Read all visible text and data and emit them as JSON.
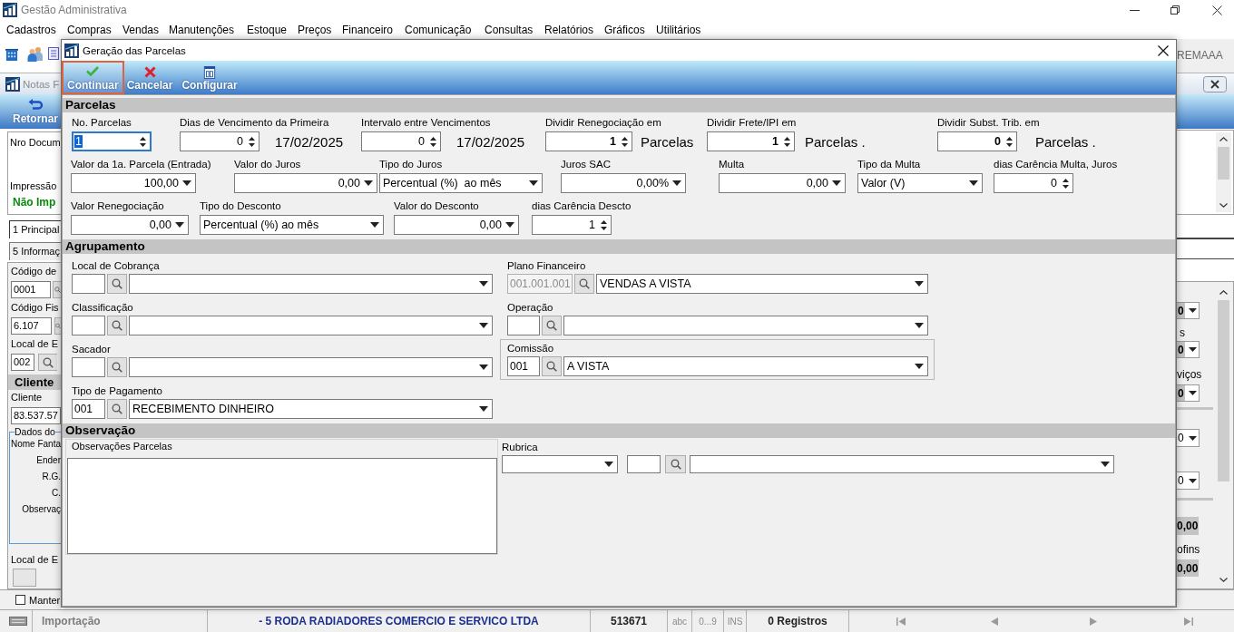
{
  "app": {
    "title": "Gestão Administrativa"
  },
  "menu": [
    "Cadastros",
    "Compras",
    "Vendas",
    "Manutenções",
    "Estoque",
    "Preços",
    "Financeiro",
    "Comunicação",
    "Consultas",
    "Relatórios",
    "Gráficos",
    "Utilitários"
  ],
  "toolbar": {
    "caption": "REMAAA"
  },
  "notas_window": {
    "title": "Notas F",
    "return_button": "Retornar",
    "header": {
      "document_label": "Nro Docum",
      "print_label": "Impressão",
      "print_status": "Não Imp"
    },
    "tabs": [
      {
        "label": "1 Principal",
        "selected": true
      },
      {
        "label": "5 Informaç",
        "selected": false
      }
    ],
    "fields": [
      {
        "label": "Código de",
        "value": "0001"
      },
      {
        "label": "Código Fis",
        "value": "6.107"
      },
      {
        "label": "Local de E",
        "value": "002"
      }
    ],
    "client_section": {
      "title": "Cliente",
      "label": "Cliente",
      "value": "83.537.57"
    },
    "client_data": {
      "title": "Dados do",
      "labels": [
        "Nome Fanta",
        "Ender",
        "R.G.",
        "C.",
        "Observaç"
      ]
    },
    "location_label": "Local de E",
    "keep_option": {
      "label": "Manter",
      "checked": false
    },
    "right_panel": [
      {
        "kind": "dropdown",
        "value": "0",
        "highlighted": true
      },
      {
        "kind": "label",
        "text": "s"
      },
      {
        "kind": "dropdown",
        "value": "0",
        "highlighted": true
      },
      {
        "kind": "label",
        "text": "viços"
      },
      {
        "kind": "dropdown",
        "value": "0",
        "highlighted": true
      },
      {
        "kind": "separator"
      },
      {
        "kind": "dropdown",
        "value": "0",
        "highlighted": false
      },
      {
        "kind": "dropdown",
        "value": "0",
        "highlighted": false
      },
      {
        "kind": "separator"
      },
      {
        "kind": "total",
        "value": "0,00"
      },
      {
        "kind": "label",
        "text": "ofins"
      },
      {
        "kind": "total",
        "value": "0,00"
      }
    ]
  },
  "dialog": {
    "title": "Geração das Parcelas",
    "actions": [
      {
        "kind": "confirm",
        "label": "Continuar",
        "selected": true
      },
      {
        "kind": "cancel",
        "label": "Cancelar",
        "selected": false
      },
      {
        "kind": "configure",
        "label": "Configurar",
        "selected": false
      }
    ],
    "parcelas": {
      "title": "Parcelas",
      "lines": [
        {
          "fields": [
            {
              "kind": "spin",
              "label": "No. Parcelas",
              "value": "1",
              "bold": false,
              "focused": true
            },
            {
              "kind": "spin",
              "label": "Dias de Vencimento da Primeira",
              "value": "0",
              "bold": false,
              "focused": false,
              "suffix": "17/02/2025"
            },
            {
              "kind": "spin",
              "label": "Intervalo entre Vencimentos",
              "value": "0",
              "bold": false,
              "focused": false,
              "suffix": "17/02/2025"
            },
            {
              "kind": "spin",
              "label": "Dividir Renegociação em",
              "value": "1",
              "bold": true,
              "focused": false,
              "suffix": "Parcelas"
            },
            {
              "kind": "spin",
              "label": "Dividir Frete/IPI em",
              "value": "1",
              "bold": true,
              "focused": false,
              "suffix": "Parcelas ."
            },
            {
              "kind": "spin",
              "label": "Dividir Subst. Trib. em",
              "value": "0",
              "bold": true,
              "focused": false,
              "suffix": "Parcelas ."
            }
          ]
        },
        {
          "fields": [
            {
              "kind": "amount",
              "label": "Valor da 1a. Parcela (Entrada)",
              "value": "100,00"
            },
            {
              "kind": "amount",
              "label": "Valor do Juros",
              "value": "0,00"
            },
            {
              "kind": "combo",
              "label": "Tipo do Juros",
              "value": "Percentual (%)  ao mês"
            },
            {
              "kind": "amount",
              "label": "Juros SAC",
              "value": "0,00%"
            },
            {
              "kind": "amount",
              "label": "Multa",
              "value": "0,00"
            },
            {
              "kind": "combo",
              "label": "Tipo da Multa",
              "value": "Valor (V)"
            },
            {
              "kind": "spin",
              "label": "dias Carência Multa, Juros",
              "value": "0",
              "bold": false,
              "focused": false
            }
          ]
        },
        {
          "fields": [
            {
              "kind": "amount",
              "label": "Valor Renegociação",
              "value": "0,00"
            },
            {
              "kind": "combo",
              "label": "Tipo do Desconto",
              "value": "Percentual (%) ao mês"
            },
            {
              "kind": "amount",
              "label": "Valor do Desconto",
              "value": "0,00"
            },
            {
              "kind": "spin",
              "label": "dias Carência Descto",
              "value": "1",
              "bold": false,
              "focused": false
            }
          ]
        }
      ]
    },
    "agrupamento": {
      "title": "Agrupamento",
      "left": [
        {
          "kind": "lookup",
          "label": "Local de Cobrança",
          "disabled": false
        },
        {
          "kind": "lookup",
          "label": "Classificação",
          "disabled": false
        },
        {
          "kind": "lookup",
          "label": "Sacador",
          "disabled": false
        },
        {
          "kind": "lookup",
          "label": "Tipo de Pagamento",
          "code": "001",
          "value": "RECEBIMENTO DINHEIRO",
          "disabled": false
        }
      ],
      "right": [
        {
          "kind": "lookup",
          "label": "Plano Financeiro",
          "code": "001.001.001",
          "value": "VENDAS A VISTA",
          "disabled": true
        },
        {
          "kind": "lookup",
          "label": "Operação",
          "disabled": false
        },
        {
          "kind": "boxed_lookup",
          "label": "Comissão",
          "code": "001",
          "value": "A VISTA",
          "disabled": false
        }
      ]
    },
    "observacao": {
      "title": "Observação",
      "notes_label": "Observações Parcelas",
      "rubrica_label": "Rubrica"
    }
  },
  "status_bar": {
    "module": "Importação",
    "company": "- 5 RODA RADIADORES COMERCIO E SERVICO LTDA",
    "code": "513671",
    "indicators": [
      "abc",
      "0...9",
      "INS"
    ],
    "records": "0 Registros"
  }
}
